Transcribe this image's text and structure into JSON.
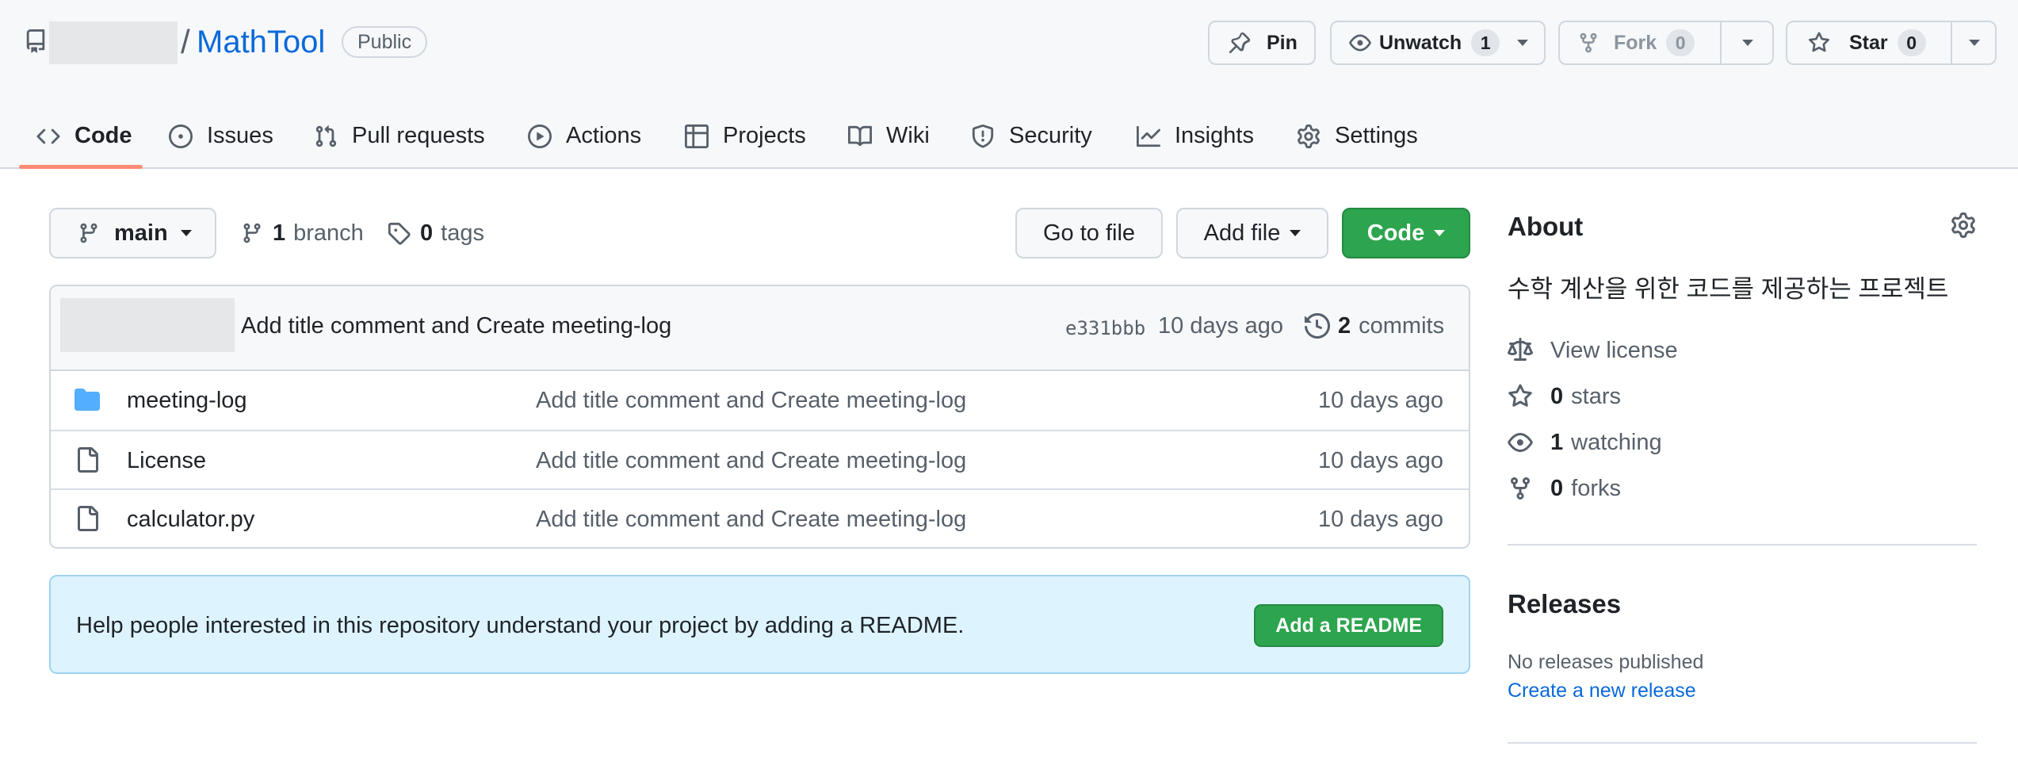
{
  "repo": {
    "name": "MathTool",
    "separator": "/",
    "visibility": "Public"
  },
  "actions": {
    "pin_label": "Pin",
    "unwatch_label": "Unwatch",
    "watch_count": "1",
    "fork_label": "Fork",
    "fork_count": "0",
    "star_label": "Star",
    "star_count": "0"
  },
  "tabs": [
    {
      "label": "Code",
      "icon": "code-icon",
      "active": true
    },
    {
      "label": "Issues",
      "icon": "issue-icon"
    },
    {
      "label": "Pull requests",
      "icon": "pull-request-icon"
    },
    {
      "label": "Actions",
      "icon": "play-icon"
    },
    {
      "label": "Projects",
      "icon": "table-icon"
    },
    {
      "label": "Wiki",
      "icon": "book-icon"
    },
    {
      "label": "Security",
      "icon": "shield-icon"
    },
    {
      "label": "Insights",
      "icon": "graph-icon"
    },
    {
      "label": "Settings",
      "icon": "gear-icon"
    }
  ],
  "toolbar": {
    "branch": "main",
    "branch_count": "1",
    "branch_label": "branch",
    "tag_count": "0",
    "tag_label": "tags",
    "go_to_file": "Go to file",
    "add_file": "Add file",
    "code": "Code"
  },
  "latest_commit": {
    "message": "Add title comment and Create meeting-log",
    "hash": "e331bbb",
    "time": "10 days ago",
    "commit_count": "2",
    "commit_label": "commits"
  },
  "files": [
    {
      "name": "meeting-log",
      "type": "folder",
      "message": "Add title comment and Create meeting-log",
      "time": "10 days ago"
    },
    {
      "name": "License",
      "type": "file",
      "message": "Add title comment and Create meeting-log",
      "time": "10 days ago"
    },
    {
      "name": "calculator.py",
      "type": "file",
      "message": "Add title comment and Create meeting-log",
      "time": "10 days ago"
    }
  ],
  "readme": {
    "prompt": "Help people interested in this repository understand your project by adding a README.",
    "button": "Add a README"
  },
  "about": {
    "title": "About",
    "description": "수학 계산을 위한 코드를 제공하는 프로젝트",
    "license": "View license",
    "stars_count": "0",
    "stars_label": "stars",
    "watching_count": "1",
    "watching_label": "watching",
    "forks_count": "0",
    "forks_label": "forks"
  },
  "releases": {
    "title": "Releases",
    "empty": "No releases published",
    "create_link": "Create a new release"
  },
  "colors": {
    "accent_link": "#0969da",
    "primary_green": "#2da44e",
    "active_tab_underline": "#fd8c73",
    "readme_bg": "#ddf4ff",
    "folder_blue": "#54aeff"
  }
}
